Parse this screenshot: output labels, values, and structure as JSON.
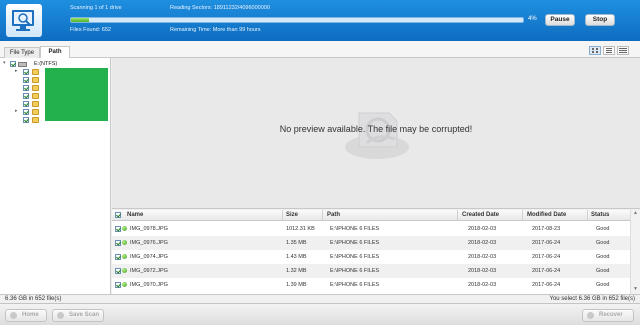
{
  "scan": {
    "scanning_text": "Scanning 1 of 1 drive",
    "reading_sectors": "Reading Sectors: 18911232/4096000000",
    "files_found": "Files Found: 652",
    "remaining_time": "Remaining Time: More than 99 hours",
    "progress_percent": 4,
    "progress_label": "4%",
    "pause_label": "Pause",
    "stop_label": "Stop"
  },
  "tabs": {
    "file_type": "File Type",
    "path": "Path"
  },
  "tree": {
    "drive_label": "E:(NTFS)"
  },
  "preview": {
    "message": "No preview available. The file may be corrupted!"
  },
  "table": {
    "headers": {
      "name": "Name",
      "size": "Size",
      "path": "Path",
      "created": "Created Date",
      "modified": "Modified Date",
      "status": "Status"
    },
    "rows": [
      {
        "name": "IMG_0978.JPG",
        "size": "1012.31 KB",
        "path": "E:\\IPHONE 6 FILES",
        "created": "2018-02-03",
        "modified": "2017-08-23",
        "status": "Good"
      },
      {
        "name": "IMG_0976.JPG",
        "size": "1.35 MB",
        "path": "E:\\IPHONE 6 FILES",
        "created": "2018-02-03",
        "modified": "2017-06-24",
        "status": "Good"
      },
      {
        "name": "IMG_0974.JPG",
        "size": "1.43 MB",
        "path": "E:\\IPHONE 6 FILES",
        "created": "2018-02-03",
        "modified": "2017-06-24",
        "status": "Good"
      },
      {
        "name": "IMG_0972.JPG",
        "size": "1.32 MB",
        "path": "E:\\IPHONE 6 FILES",
        "created": "2018-02-03",
        "modified": "2017-06-24",
        "status": "Good"
      },
      {
        "name": "IMG_0970.JPG",
        "size": "1.39 MB",
        "path": "E:\\IPHONE 6 FILES",
        "created": "2018-02-03",
        "modified": "2017-06-24",
        "status": "Good"
      }
    ]
  },
  "status": {
    "left": "6.36 GB in 652 file(s)",
    "right": "You select 6.36 GB in 652 file(s)"
  },
  "bottom": {
    "home": "Home",
    "save_scan": "Save Scan",
    "recover": "Recover"
  },
  "colors": {
    "topbar": "#1677cc",
    "progress": "#5cc232",
    "redacted_block": "#22b14c"
  }
}
